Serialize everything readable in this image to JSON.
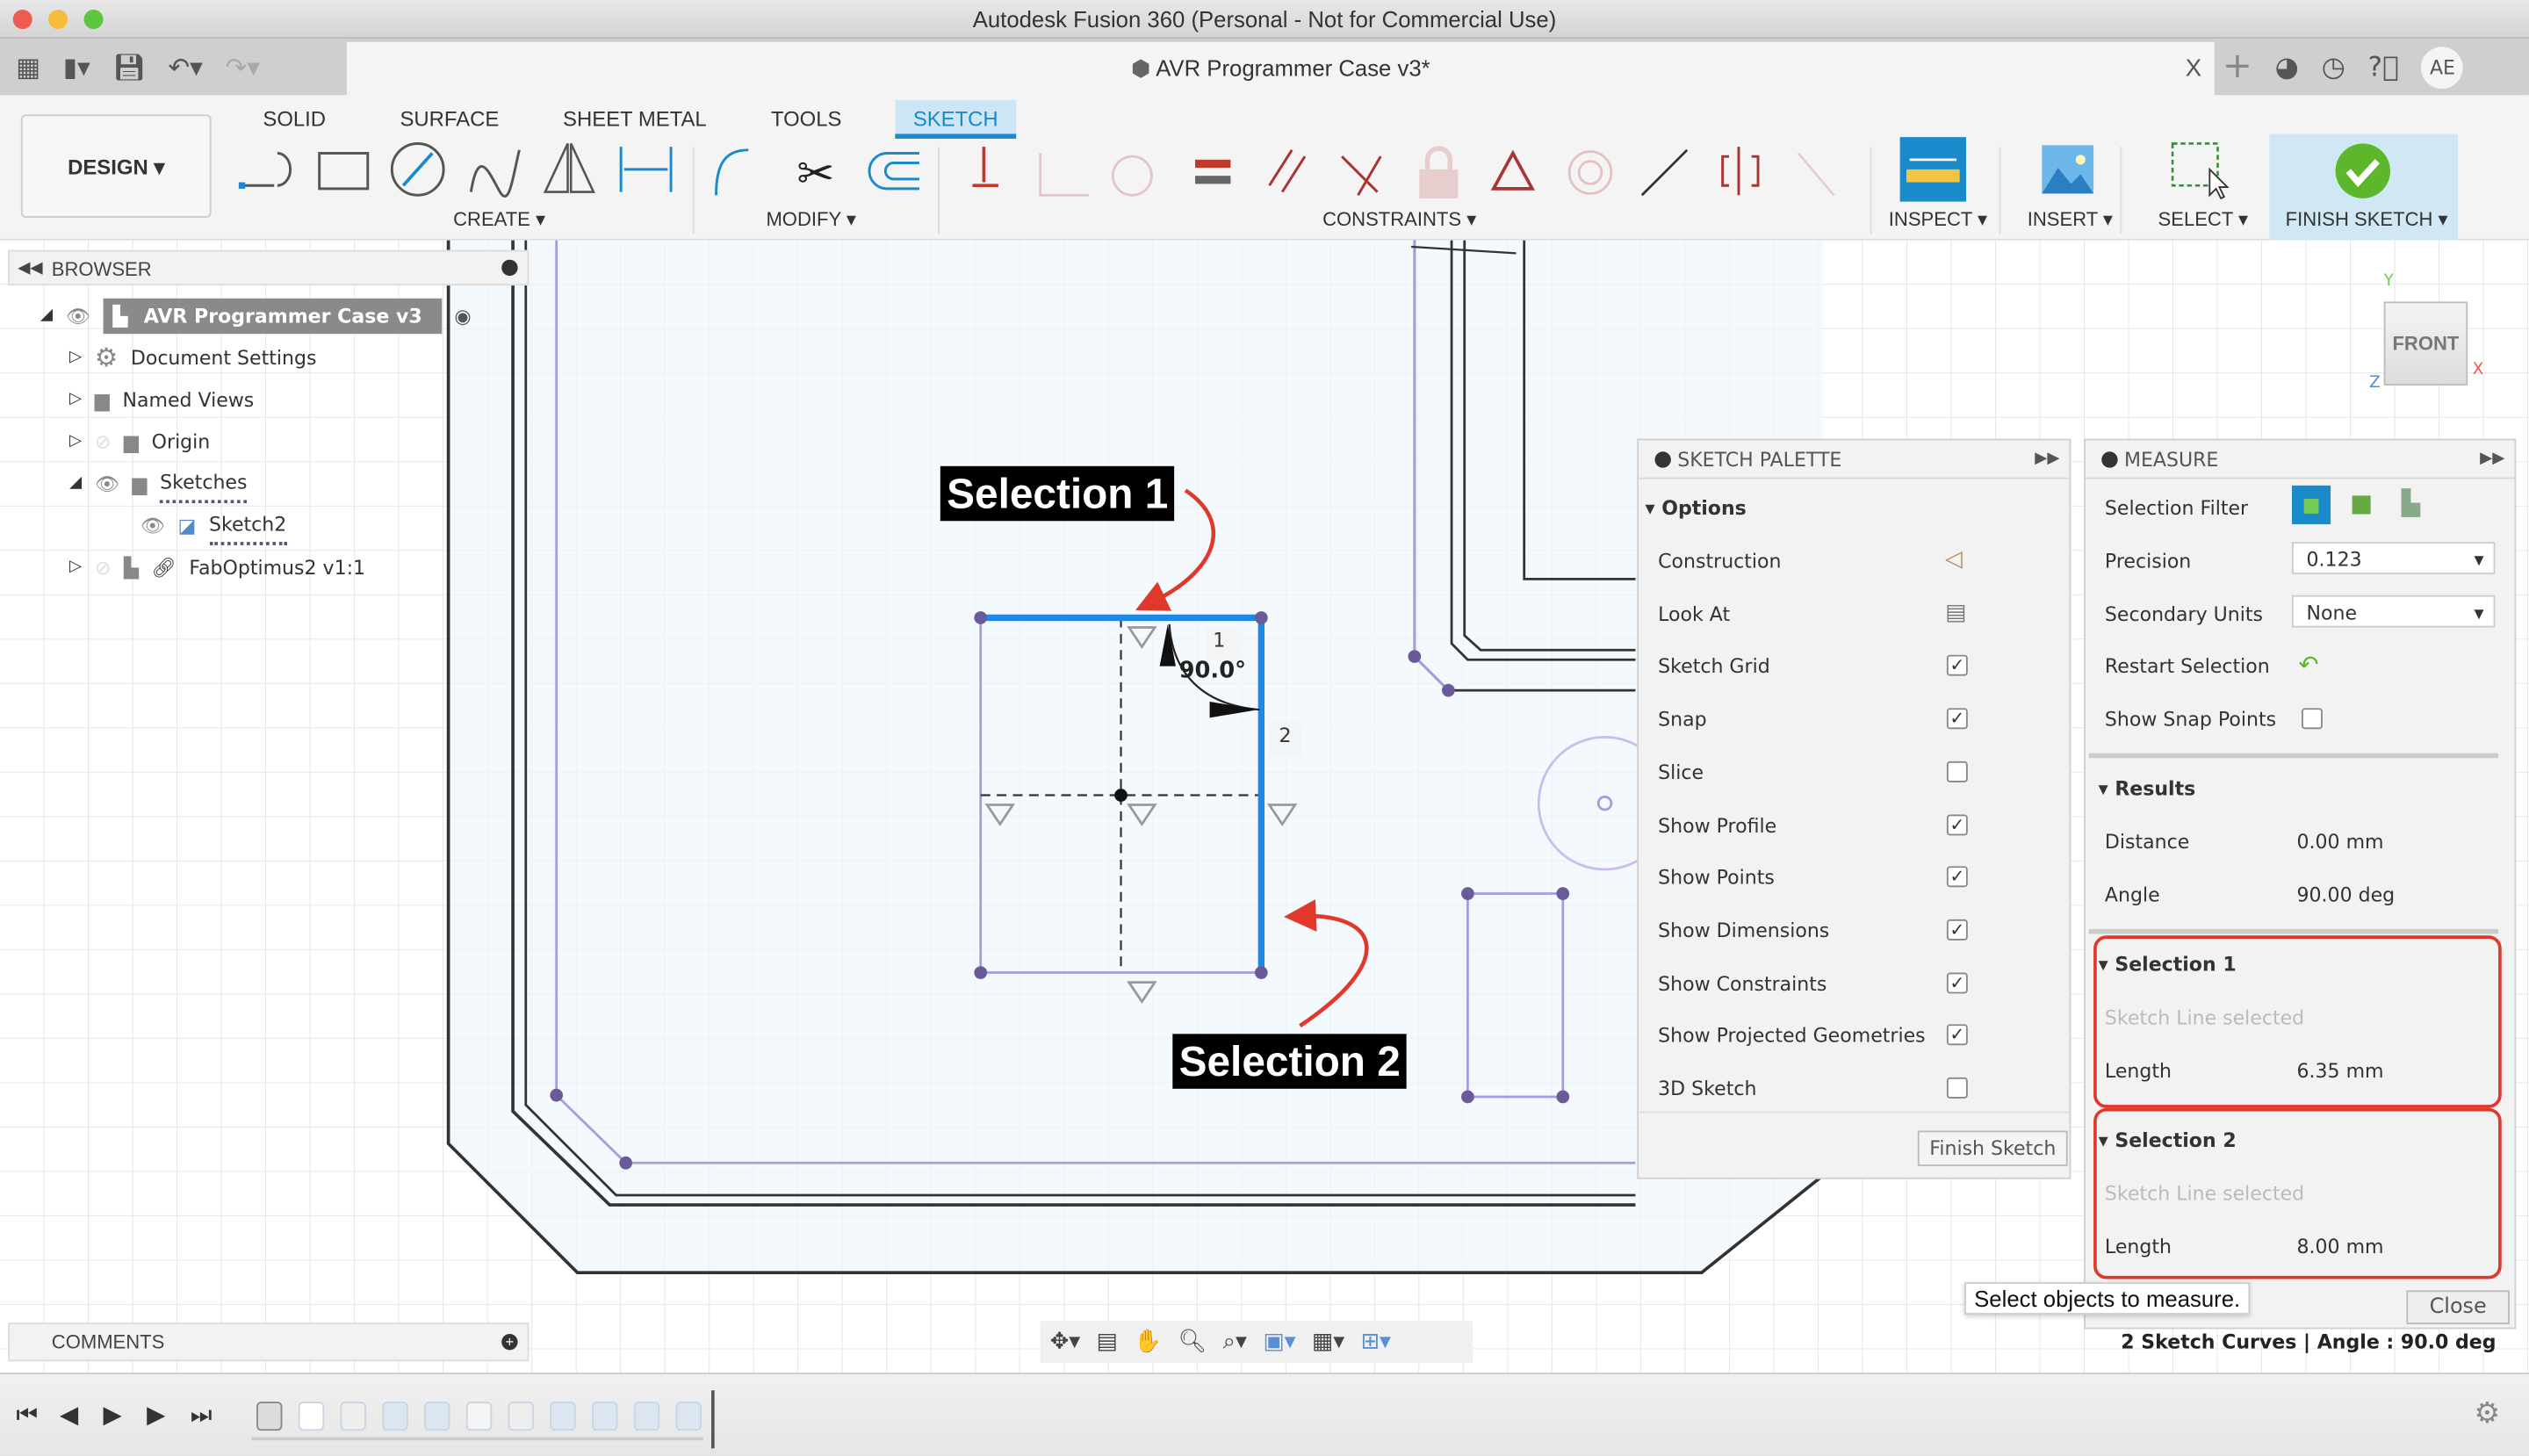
{
  "window": {
    "title": "Autodesk Fusion 360 (Personal - Not for Commercial Use)"
  },
  "doc_tab": {
    "title": "AVR Programmer Case v3*",
    "close": "X"
  },
  "user": {
    "initials": "AE"
  },
  "workspace": {
    "label": "DESIGN ▾"
  },
  "ribbon_tabs": [
    {
      "label": "SOLID"
    },
    {
      "label": "SURFACE"
    },
    {
      "label": "SHEET METAL"
    },
    {
      "label": "TOOLS"
    },
    {
      "label": "SKETCH",
      "active": true
    }
  ],
  "groups": {
    "create": "CREATE ▾",
    "modify": "MODIFY ▾",
    "constraints": "CONSTRAINTS ▾",
    "inspect": "INSPECT ▾",
    "insert": "INSERT ▾",
    "select": "SELECT ▾",
    "finish": "FINISH SKETCH ▾"
  },
  "browser": {
    "title": "BROWSER",
    "items": [
      {
        "label": "AVR Programmer Case v3"
      },
      {
        "label": "Document Settings"
      },
      {
        "label": "Named Views"
      },
      {
        "label": "Origin"
      },
      {
        "label": "Sketches"
      },
      {
        "label": "Sketch2"
      },
      {
        "label": "FabOptimus2 v1:1"
      }
    ]
  },
  "comments": {
    "title": "COMMENTS"
  },
  "viewcube": {
    "face": "FRONT"
  },
  "annotations": {
    "sel1": "Selection 1",
    "sel2": "Selection 2",
    "angle": "90.0°",
    "marker1": "1",
    "marker2": "2"
  },
  "sketch_palette": {
    "title": "SKETCH PALETTE",
    "section": "Options",
    "options": [
      {
        "label": "Construction",
        "type": "icon"
      },
      {
        "label": "Look At",
        "type": "icon"
      },
      {
        "label": "Sketch Grid",
        "checked": true
      },
      {
        "label": "Snap",
        "checked": true
      },
      {
        "label": "Slice",
        "checked": false
      },
      {
        "label": "Show Profile",
        "checked": true
      },
      {
        "label": "Show Points",
        "checked": true
      },
      {
        "label": "Show Dimensions",
        "checked": true
      },
      {
        "label": "Show Constraints",
        "checked": true
      },
      {
        "label": "Show Projected Geometries",
        "checked": true
      },
      {
        "label": "3D Sketch",
        "checked": false
      }
    ],
    "finish_button": "Finish Sketch"
  },
  "measure": {
    "title": "MEASURE",
    "selection_filter_label": "Selection Filter",
    "precision_label": "Precision",
    "precision_value": "0.123",
    "secondary_units_label": "Secondary Units",
    "secondary_units_value": "None",
    "restart_label": "Restart Selection",
    "snap_points_label": "Show Snap Points",
    "snap_points_checked": false,
    "results": {
      "title": "Results",
      "distance_label": "Distance",
      "distance": "0.00 mm",
      "angle_label": "Angle",
      "angle": "90.00 deg"
    },
    "selection1": {
      "title": "Selection 1",
      "status": "Sketch Line selected",
      "length_label": "Length",
      "length": "6.35 mm"
    },
    "selection2": {
      "title": "Selection 2",
      "status": "Sketch Line selected",
      "length_label": "Length",
      "length": "8.00 mm"
    },
    "close": "Close",
    "tooltip": "Select objects to measure."
  },
  "status": {
    "text": "2 Sketch Curves | Angle : 90.0 deg"
  },
  "colors": {
    "accent": "#1a8acb",
    "selection": "#1e88e5",
    "annotation_red": "#e0392b",
    "finish_green": "#5cb82a"
  }
}
